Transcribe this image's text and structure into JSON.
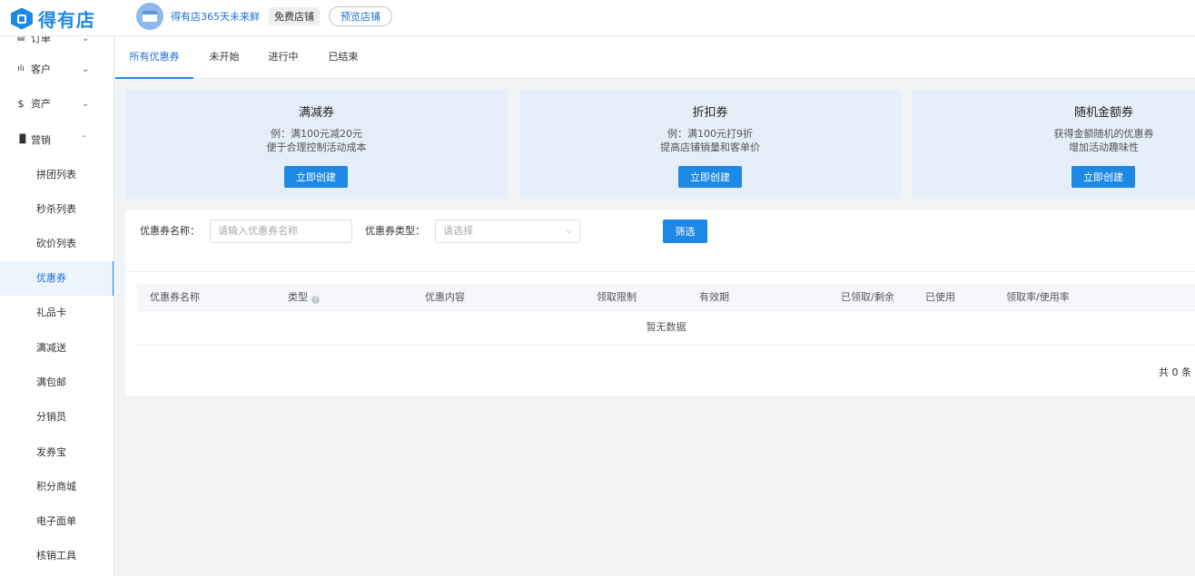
{
  "header": {
    "logo_text": "得有店",
    "store_name": "得有店365天未来鲜",
    "plan_badge": "免费店铺",
    "preview_button": "预览店铺"
  },
  "sidebar": {
    "groups": [
      {
        "label": "订单",
        "icon": "order-icon",
        "expanded": false
      },
      {
        "label": "客户",
        "icon": "customer-icon",
        "expanded": false
      },
      {
        "label": "资产",
        "icon": "dollar-icon",
        "expanded": false
      },
      {
        "label": "营销",
        "icon": "chart-icon",
        "expanded": true
      }
    ],
    "marketing_items": [
      "拼团列表",
      "秒杀列表",
      "砍价列表",
      "优惠券",
      "礼品卡",
      "满减送",
      "满包邮",
      "分销员",
      "发券宝",
      "积分商城",
      "电子面单",
      "核销工具"
    ],
    "active_item": "优惠券"
  },
  "tabs": [
    "所有优惠券",
    "未开始",
    "进行中",
    "已结束"
  ],
  "active_tab": "所有优惠券",
  "coupon_types": [
    {
      "title": "满减券",
      "desc_line1": "例：满100元减20元",
      "desc_line2": "便于合理控制活动成本",
      "button": "立即创建"
    },
    {
      "title": "折扣券",
      "desc_line1": "例：满100元打9折",
      "desc_line2": "提高店铺销量和客单价",
      "button": "立即创建"
    },
    {
      "title": "随机金额券",
      "desc_line1": "获得金额随机的优惠券",
      "desc_line2": "增加活动趣味性",
      "button": "立即创建"
    }
  ],
  "filters": {
    "name_label": "优惠券名称：",
    "name_placeholder": "请输入优惠券名称",
    "type_label": "优惠券类型：",
    "type_placeholder": "请选择",
    "filter_button": "筛选"
  },
  "table": {
    "columns": [
      "优惠券名称",
      "类型",
      "优惠内容",
      "领取限制",
      "有效期",
      "已领取/剩余",
      "已使用",
      "领取率/使用率"
    ],
    "empty_text": "暂无数据",
    "total_text": "共 0 条"
  },
  "colors": {
    "primary": "#1e88e5",
    "card_bg": "#e6eef9",
    "page_bg": "#f2f3f5"
  }
}
